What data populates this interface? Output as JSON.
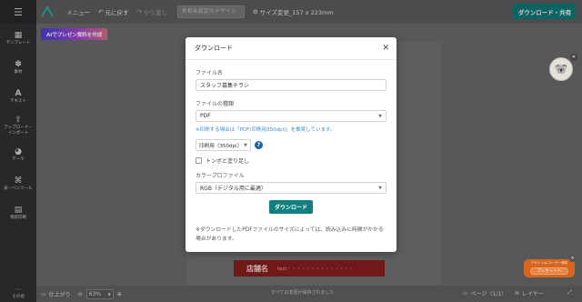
{
  "header": {
    "menu_label": "メニュー",
    "undo_label": "元に戻す",
    "redo_label": "やり直し",
    "design_name_placeholder": "名称未設定のデザイン",
    "size_change_label": "サイズ変更_157 x 223mm",
    "download_share_label": "ダウンロード・共有"
  },
  "sidebar": {
    "items": [
      {
        "icon": "template-icon",
        "label": "テンプレート"
      },
      {
        "icon": "material-icon",
        "label": "素材"
      },
      {
        "icon": "text-icon",
        "label": "テキスト"
      },
      {
        "icon": "upload-icon",
        "label": "アップロード・\nインポート"
      },
      {
        "icon": "theme-icon",
        "label": "テーマ"
      },
      {
        "icon": "chart-icon",
        "label": "表・ベンツール"
      },
      {
        "icon": "print-icon",
        "label": "領収印刷"
      }
    ],
    "bottom_label": "その他"
  },
  "canvas": {
    "ai_button_label": "AIでプレゼン資料を作成",
    "store_name": "店舗名",
    "store_text": "text・・・・・・・・・・・・・・"
  },
  "survey": {
    "title": "デザインACユーザー様向",
    "button_label": "アンケートへ"
  },
  "bottom_bar": {
    "finish_label": "仕上がり",
    "zoom_value": "63%",
    "saved_status": "すべての変更が保存されました",
    "page_label": "ページ（1/1）",
    "layer_label": "レイヤー"
  },
  "modal": {
    "title": "ダウンロード",
    "file_name_label": "ファイル名",
    "file_name_value": "スタッフ募集チラシ",
    "file_type_label": "ファイルの種類",
    "file_type_value": "PDF",
    "print_note": "※印刷する場合は「PDF(印刷用350dpi)」を推奨しています。",
    "quality_value": "印刷用（350dpi）",
    "crop_marks_label": "トンボと塗り足し",
    "color_profile_label": "カラープロファイル",
    "color_profile_value": "RGB（デジタル用に最適）",
    "download_button_label": "ダウンロード",
    "footnote": "※ダウンロードしたPDFファイルのサイズによっては、読み込みに時間がかかる場合があります。"
  },
  "colors": {
    "accent_teal": "#127e7c",
    "link_blue": "#3e8fc9",
    "help_blue": "#1d64a8",
    "banner_red": "#8e1f1f",
    "survey_orange": "#d7661f"
  }
}
